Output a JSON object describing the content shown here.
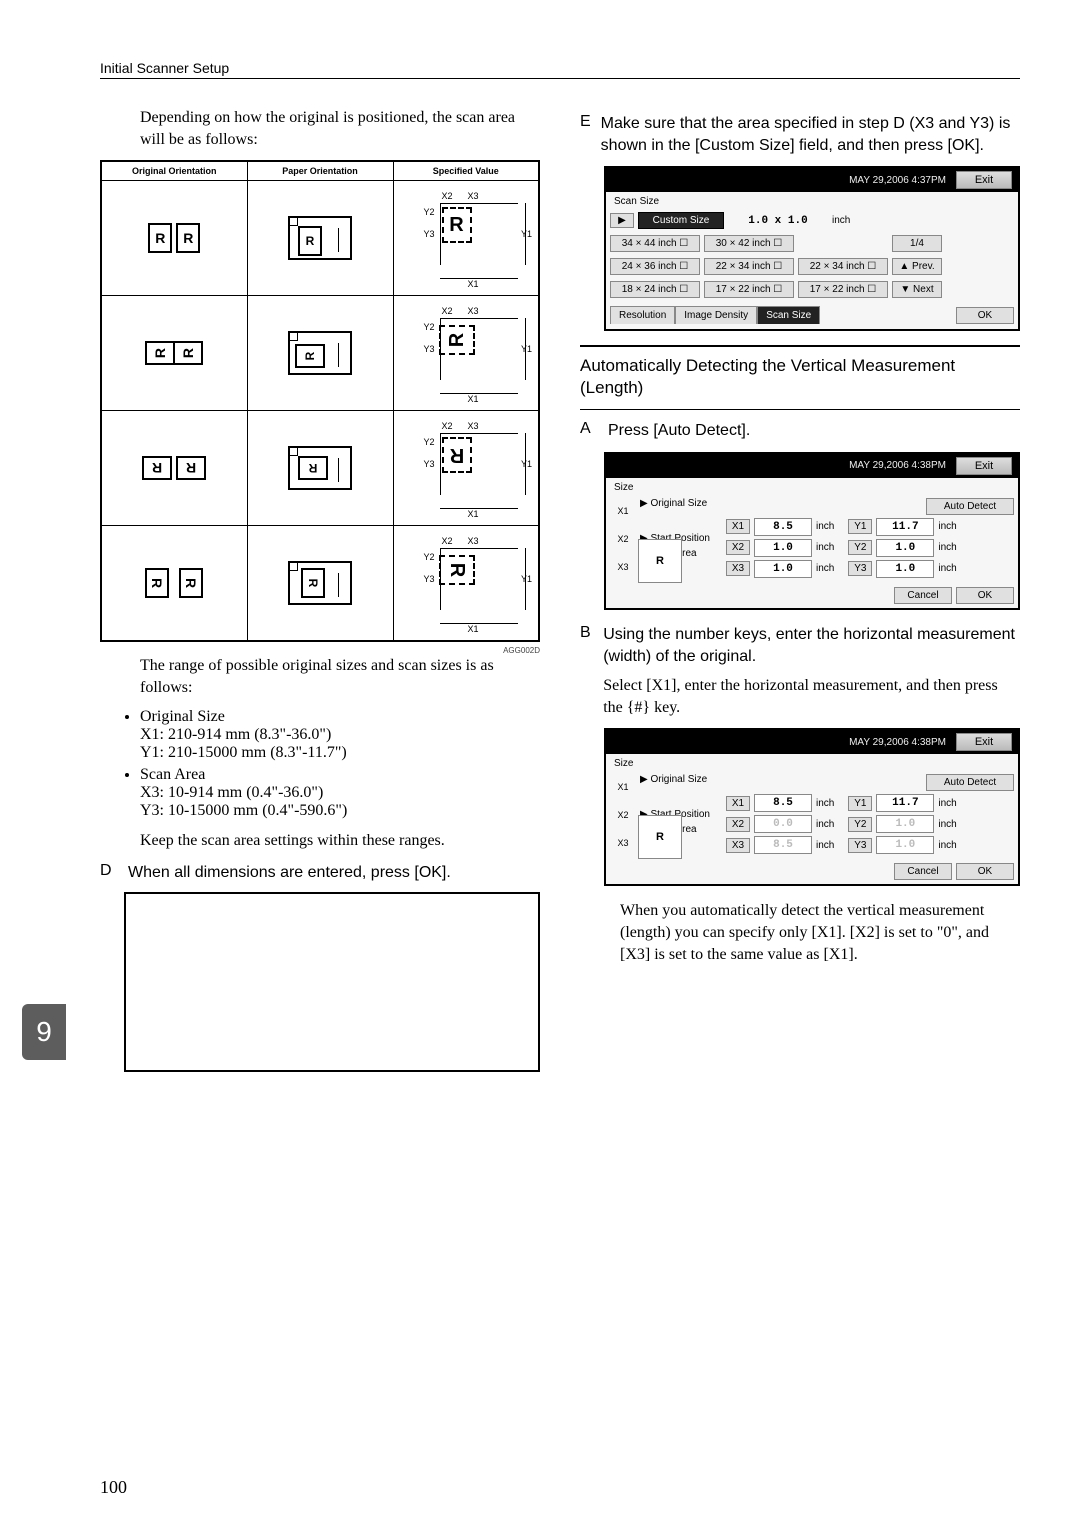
{
  "header": {
    "title": "Initial Scanner Setup"
  },
  "page_number": "100",
  "side_tab": "9",
  "left": {
    "intro": "Depending on how the original is positioned, the scan area will be as follows:",
    "orient_table": {
      "cols": [
        "Original Orientation",
        "Paper Orientation",
        "Specified Value"
      ],
      "rows": [
        {
          "orig": "R",
          "variant": "port",
          "rot": "r0"
        },
        {
          "orig": "R",
          "variant": "port",
          "rot": "r90"
        },
        {
          "orig": "R",
          "variant": "land",
          "rot": "r180"
        },
        {
          "orig": "R",
          "variant": "land",
          "rot": "r270"
        }
      ],
      "labels": {
        "x1": "X1",
        "x2": "X2",
        "x3": "X3",
        "y1": "Y1",
        "y2": "Y2",
        "y3": "Y3"
      },
      "code": "AGG002D"
    },
    "range_text": "The range of possible original sizes and scan sizes is as follows:",
    "bullets": [
      {
        "title": "Original Size",
        "l1": "X1: 210-914 mm (8.3\"-36.0\")",
        "l2": "Y1: 210-15000 mm (8.3\"-11.7\")"
      },
      {
        "title": "Scan Area",
        "l1": "X3: 10-914 mm (0.4\"-36.0\")",
        "l2": "Y3: 10-15000 mm (0.4\"-590.6\")"
      }
    ],
    "keep_text": "Keep the scan area settings within these ranges.",
    "stepD": "When all dimensions are entered, press [OK]."
  },
  "right": {
    "stepE": "Make sure that the area specified in step D (X3 and Y3) is shown in the [Custom Size] field, and then press [OK].",
    "lcd1": {
      "timestamp": "MAY  29,2006  4:37PM",
      "exit": "Exit",
      "section": "Scan Size",
      "custom": "Custom Size",
      "cust_val": "1.0 x     1.0",
      "cust_unit": "inch",
      "sizes": [
        [
          "34 × 44 inch ☐",
          "30 × 42 inch ☐",
          "",
          "1/4"
        ],
        [
          "24 × 36 inch ☐",
          "22 × 34 inch ☐",
          "22 × 34 inch ☐",
          "▲ Prev."
        ],
        [
          "18 × 24 inch ☐",
          "17 × 22 inch ☐",
          "17 × 22 inch ☐",
          "▼ Next"
        ]
      ],
      "tabs": [
        "Resolution",
        "Image Density",
        "Scan Size"
      ],
      "ok": "OK"
    },
    "subsection": "Automatically Detecting the Vertical Measurement (Length)",
    "stepA": "Press [Auto Detect].",
    "lcd2": {
      "timestamp": "MAY  29,2006  4:38PM",
      "exit": "Exit",
      "section": "Size",
      "labels": {
        "orig": "▶ Original Size",
        "start": "▶ Start Position",
        "area": "▶ Scan Area",
        "auto": "Auto Detect"
      },
      "rows": [
        {
          "k": "X1",
          "v": "8.5",
          "u": "inch",
          "k2": "Y1",
          "v2": "11.7",
          "u2": "inch"
        },
        {
          "k": "X2",
          "v": "1.0",
          "u": "inch",
          "k2": "Y2",
          "v2": "1.0",
          "u2": "inch"
        },
        {
          "k": "X3",
          "v": "1.0",
          "u": "inch",
          "k2": "Y3",
          "v2": "1.0",
          "u2": "inch"
        }
      ],
      "cancel": "Cancel",
      "ok": "OK",
      "ruler": [
        "X1",
        "X2",
        "X3"
      ],
      "preview": "R"
    },
    "stepB": {
      "line1": "Using the number keys, enter the horizontal measurement (width) of the original.",
      "line2": "Select [X1], enter the horizontal measurement, and then press the {#} key."
    },
    "lcd3": {
      "timestamp": "MAY  29,2006  4:38PM",
      "exit": "Exit",
      "section": "Size",
      "labels": {
        "orig": "▶ Original Size",
        "start": "▶ Start Position",
        "area": "▶ Scan Area",
        "auto": "Auto Detect"
      },
      "rows": [
        {
          "k": "X1",
          "v": "8.5",
          "u": "inch",
          "k2": "Y1",
          "v2": "11.7",
          "u2": "inch",
          "dim": false
        },
        {
          "k": "X2",
          "v": "0.0",
          "u": "inch",
          "k2": "Y2",
          "v2": "1.0",
          "u2": "inch",
          "dim": true
        },
        {
          "k": "X3",
          "v": "8.5",
          "u": "inch",
          "k2": "Y3",
          "v2": "1.0",
          "u2": "inch",
          "dim": true
        }
      ],
      "cancel": "Cancel",
      "ok": "OK",
      "ruler": [
        "X1",
        "X2",
        "X3"
      ],
      "preview": "R"
    },
    "tail": "When you automatically detect the vertical measurement (length) you can specify only [X1]. [X2] is set to \"0\", and [X3] is set to the same value as [X1]."
  }
}
